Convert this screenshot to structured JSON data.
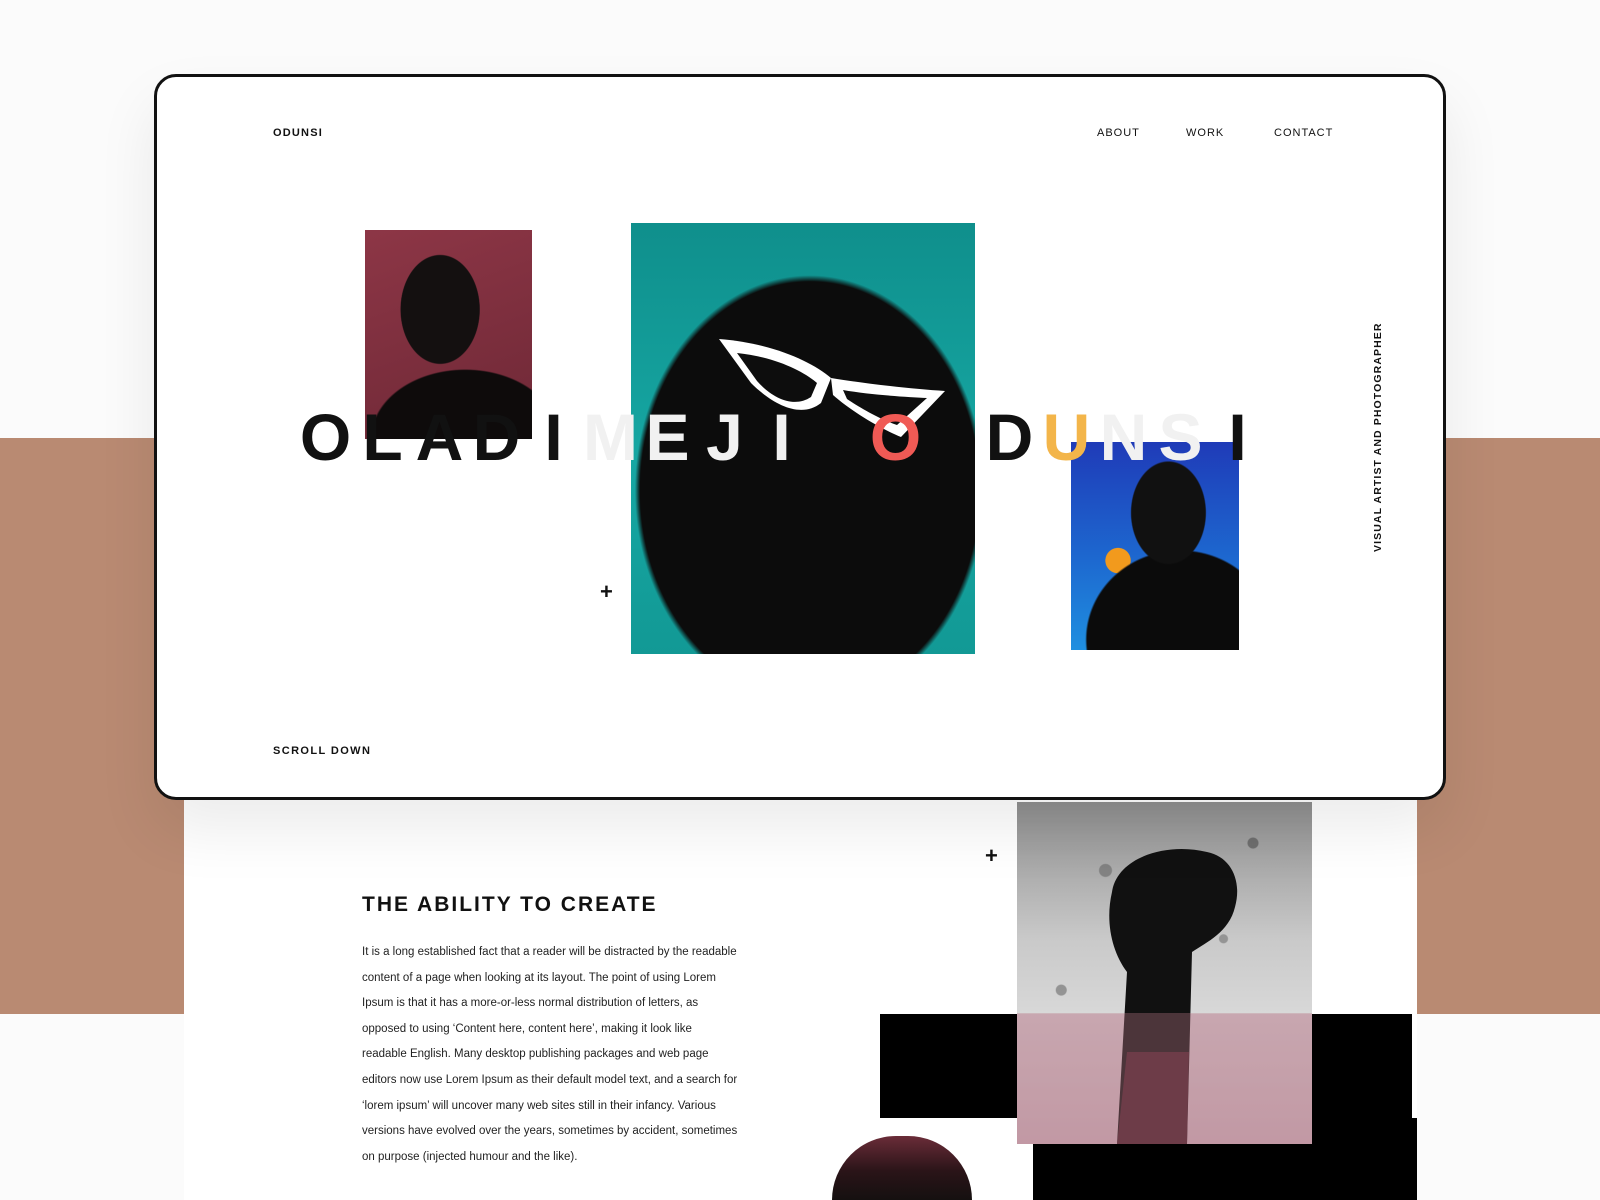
{
  "brand": {
    "logo": "ODUNSI"
  },
  "nav": {
    "items": [
      "ABOUT",
      "WORK",
      "CONTACT"
    ]
  },
  "hero": {
    "letters": [
      {
        "ch": "O",
        "color": "#111111"
      },
      {
        "ch": "L",
        "color": "#111111"
      },
      {
        "ch": "A",
        "color": "#111111"
      },
      {
        "ch": "D",
        "color": "#111111"
      },
      {
        "ch": "I",
        "color": "#111111"
      },
      {
        "ch": "M",
        "color": "#f1f1f1"
      },
      {
        "ch": "E",
        "color": "#f1f1f1"
      },
      {
        "ch": "J",
        "color": "#f1f1f1"
      },
      {
        "ch": "I",
        "color": "#f1f1f1"
      },
      {
        "ch": " ",
        "color": "#111111"
      },
      {
        "ch": "O",
        "color": "#f05a55"
      },
      {
        "ch": " ",
        "color": "#111111"
      },
      {
        "ch": "D",
        "color": "#111111"
      },
      {
        "ch": "U",
        "color": "#f3b54a"
      },
      {
        "ch": "N",
        "color": "#f1f1f1"
      },
      {
        "ch": "S",
        "color": "#f1f1f1"
      },
      {
        "ch": "I",
        "color": "#111111"
      }
    ],
    "tagline_vertical": "VISUAL ARTIST AND PHOTOGRAPHER",
    "scroll_label": "SCROLL DOWN"
  },
  "section": {
    "title": "THE ABILITY TO CREATE",
    "body": "It is a long established fact that a reader will be distracted by the readable content of a page when looking at its layout. The point of using Lorem Ipsum is that it has a more-or-less normal distribution of letters, as opposed to using ‘Content here, content here’, making it look like readable English. Many desktop publishing packages and web page editors now use Lorem Ipsum as their default model text, and a search for ‘lorem ipsum’ will uncover many web sites still in their infancy. Various versions have evolved over the years, sometimes by accident, sometimes on purpose (injected humour and the like)."
  },
  "icons": {
    "plus": "+"
  },
  "colors": {
    "accent_band": "#b98a72",
    "red": "#f05a55",
    "amber": "#f3b54a",
    "teal": "#16a7a3",
    "blue": "#1f5fd0"
  }
}
